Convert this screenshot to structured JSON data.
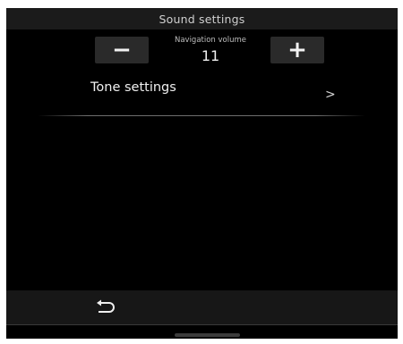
{
  "header": {
    "title": "Sound settings"
  },
  "navigation_volume": {
    "label": "Navigation volume",
    "value": "11",
    "decrease_label": "−",
    "increase_label": "+"
  },
  "tone_settings": {
    "label": "Tone settings",
    "chevron": ">"
  },
  "footer": {
    "back_icon": "back-arrow-icon"
  }
}
